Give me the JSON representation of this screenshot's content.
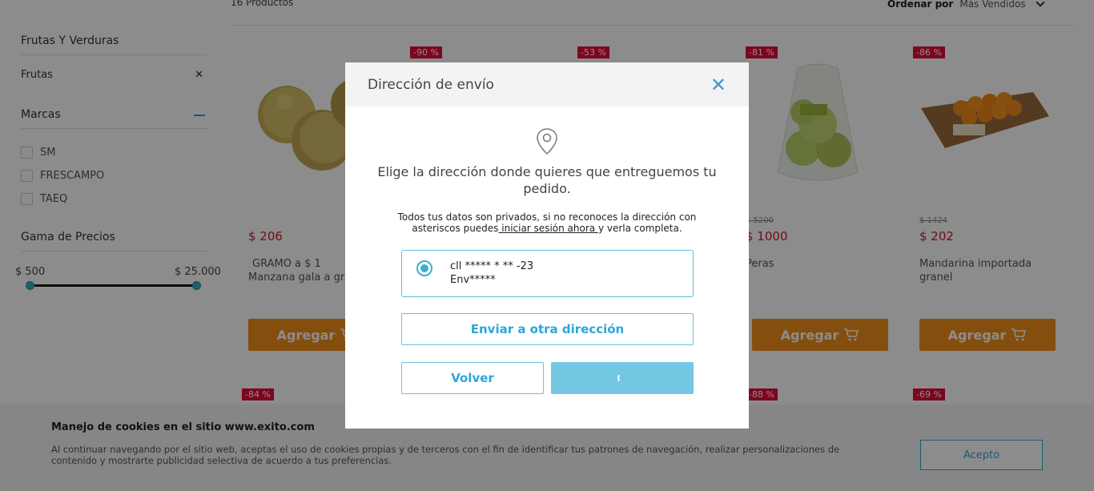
{
  "listing": {
    "results_count": "16 Productos",
    "sort_label": "Ordenar por",
    "sort_value": "Más Vendidos"
  },
  "sidebar": {
    "category_title": "Frutas Y Verduras",
    "active_filter": "Frutas",
    "brands_title": "Marcas",
    "brands": [
      "SM",
      "FRESCAMPO",
      "TAEQ"
    ],
    "price_title": "Gama de Precios",
    "price_min": "$ 500",
    "price_max": "$ 25.000"
  },
  "products": [
    {
      "badge": "",
      "old_price": "",
      "price": "$ 206",
      "name_line1": "GRAMO a $ 1",
      "name_line2": "Manzana gala a gr",
      "button": "Agregar"
    },
    {
      "badge": "-90 %",
      "old_price": "",
      "price": "",
      "name_line1": "",
      "name_line2": "",
      "button": ""
    },
    {
      "badge": "-53 %",
      "old_price": "",
      "price": "",
      "name_line1": "",
      "name_line2": "",
      "button": ""
    },
    {
      "badge": "-81 %",
      "old_price": "$ 5200",
      "price": "$ 1000",
      "name_line1": "Peras",
      "name_line2": "",
      "button": "Agregar"
    },
    {
      "badge": "-86 %",
      "old_price": "$ 1424",
      "price": "$ 202",
      "name_line1": "Mandarina importada",
      "name_line2": "granel",
      "button": "Agregar"
    }
  ],
  "second_row_badges": [
    "-84 %",
    "-88 %",
    "-69 %"
  ],
  "modal": {
    "title": "Dirección de envío",
    "lead": "Elige la dirección donde quieres que entreguemos tu pedido.",
    "note_before": "Todos tus datos son privados, si no reconoces la dirección con asteriscos puedes",
    "note_link": " iniciar sesión ahora ",
    "note_after": "y verla completa.",
    "address_line1": "cll ***** * ** -23",
    "address_line2": "Env*****",
    "other_address_button": "Enviar a otra dirección",
    "back_button": "Volver"
  },
  "cookies": {
    "title": "Manejo de cookies en el sitio www.exito.com",
    "text": "Al continuar navegando por el sitio web, aceptas el uso de cookies propias y de terceros con el fin de identificar tus patrones de navegación, realizar personalizaciones de contenido y mostrarte publicidad selectiva de acuerdo a tus preferencias.",
    "accept": "Acepto"
  },
  "colors": {
    "accent": "#2ea6d9",
    "add_button": "#f08f1b",
    "discount_badge": "#e30a3b",
    "price": "#d3142b"
  }
}
